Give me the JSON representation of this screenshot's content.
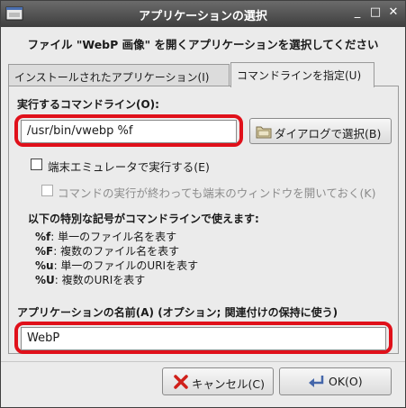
{
  "window": {
    "title": "アプリケーションの選択",
    "minimize": "_",
    "maximize": "□",
    "close": "✕"
  },
  "heading": "ファイル \"WebP 画像\" を開くアプリケーションを選択してください",
  "tabs": [
    {
      "label": "インストールされたアプリケーション(I)",
      "active": false
    },
    {
      "label": "コマンドラインを指定(U)",
      "active": true
    }
  ],
  "command": {
    "label": "実行するコマンドライン(O):",
    "value": "/usr/bin/vwebp %f",
    "browse_button": "ダイアログで選択(B)"
  },
  "options": {
    "terminal": {
      "label": "端末エミュレータで実行する(E)",
      "checked": false,
      "enabled": true
    },
    "keep_open": {
      "label": "コマンドの実行が終わっても端末のウィンドウを開いておく(K)",
      "checked": false,
      "enabled": false
    }
  },
  "codes": {
    "title": "以下の特別な記号がコマンドラインで使えます:",
    "items": [
      {
        "code": "%f",
        "desc": ": 単一のファイル名を表す"
      },
      {
        "code": "%F",
        "desc": ": 複数のファイル名を表す"
      },
      {
        "code": "%u",
        "desc": ": 単一のファイルのURIを表す"
      },
      {
        "code": "%U",
        "desc": ": 複数のURIを表す"
      }
    ]
  },
  "app_name": {
    "label": "アプリケーションの名前(A) (オプション; 関連付けの保持に使う)",
    "value": "WebP"
  },
  "buttons": {
    "cancel": "キャンセル(C)",
    "ok": "OK(O)"
  },
  "colors": {
    "highlight": "#e0101a",
    "titlebar": "#4a4a4a"
  }
}
